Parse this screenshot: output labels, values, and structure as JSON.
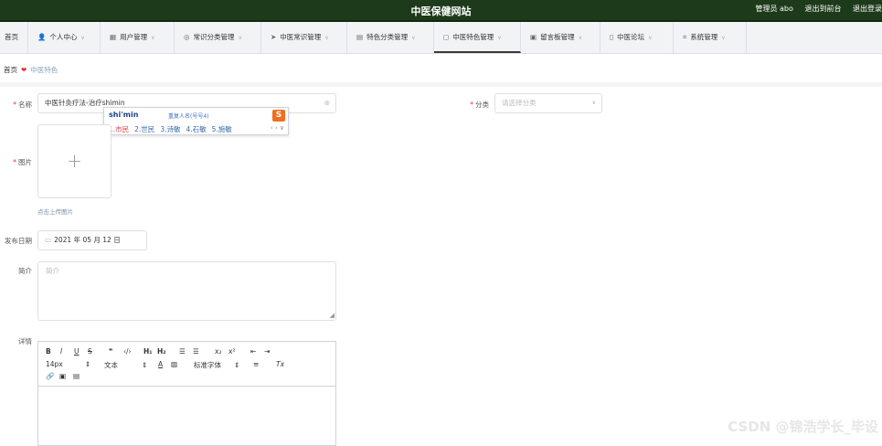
{
  "header": {
    "title": "中医保健网站",
    "user_label": "管理员 abo",
    "exit_label": "退出到前台",
    "logout_label": "退出登录"
  },
  "nav": {
    "home": "首页",
    "personal": "个人中心",
    "user_mgmt": "用户管理",
    "category_mgmt": "常识分类管理",
    "tcm_knowledge": "中医常识管理",
    "feature_category": "特色分类管理",
    "tcm_feature": "中医特色管理",
    "message_board": "留言板管理",
    "forum": "中医论坛",
    "system": "系统管理"
  },
  "breadcrumb": {
    "home": "首页",
    "current": "中医特色"
  },
  "form": {
    "name_label": "名称",
    "name_value": "中医针灸疗法-治疗shimin",
    "category_label": "分类",
    "category_placeholder": "请选择分类",
    "image_label": "图片",
    "upload_hint": "点击上传图片",
    "date_label": "发布日期",
    "date_value": "2021 年 05 月 12 日",
    "intro_label": "简介",
    "intro_placeholder": "简介",
    "detail_label": "详情"
  },
  "ime": {
    "composition": "shi'min",
    "hint": "重复人名(号号4)",
    "logo": "S",
    "candidates": [
      "1.市民",
      "2.世民",
      "3.诗敏",
      "4.石敏",
      "5.施敏"
    ],
    "arrows": "‹ › ∨"
  },
  "editor": {
    "font_size": "14px",
    "text_style": "文本",
    "font_family": "标准字体"
  },
  "watermark": "CSDN @锦浩学长_毕设"
}
